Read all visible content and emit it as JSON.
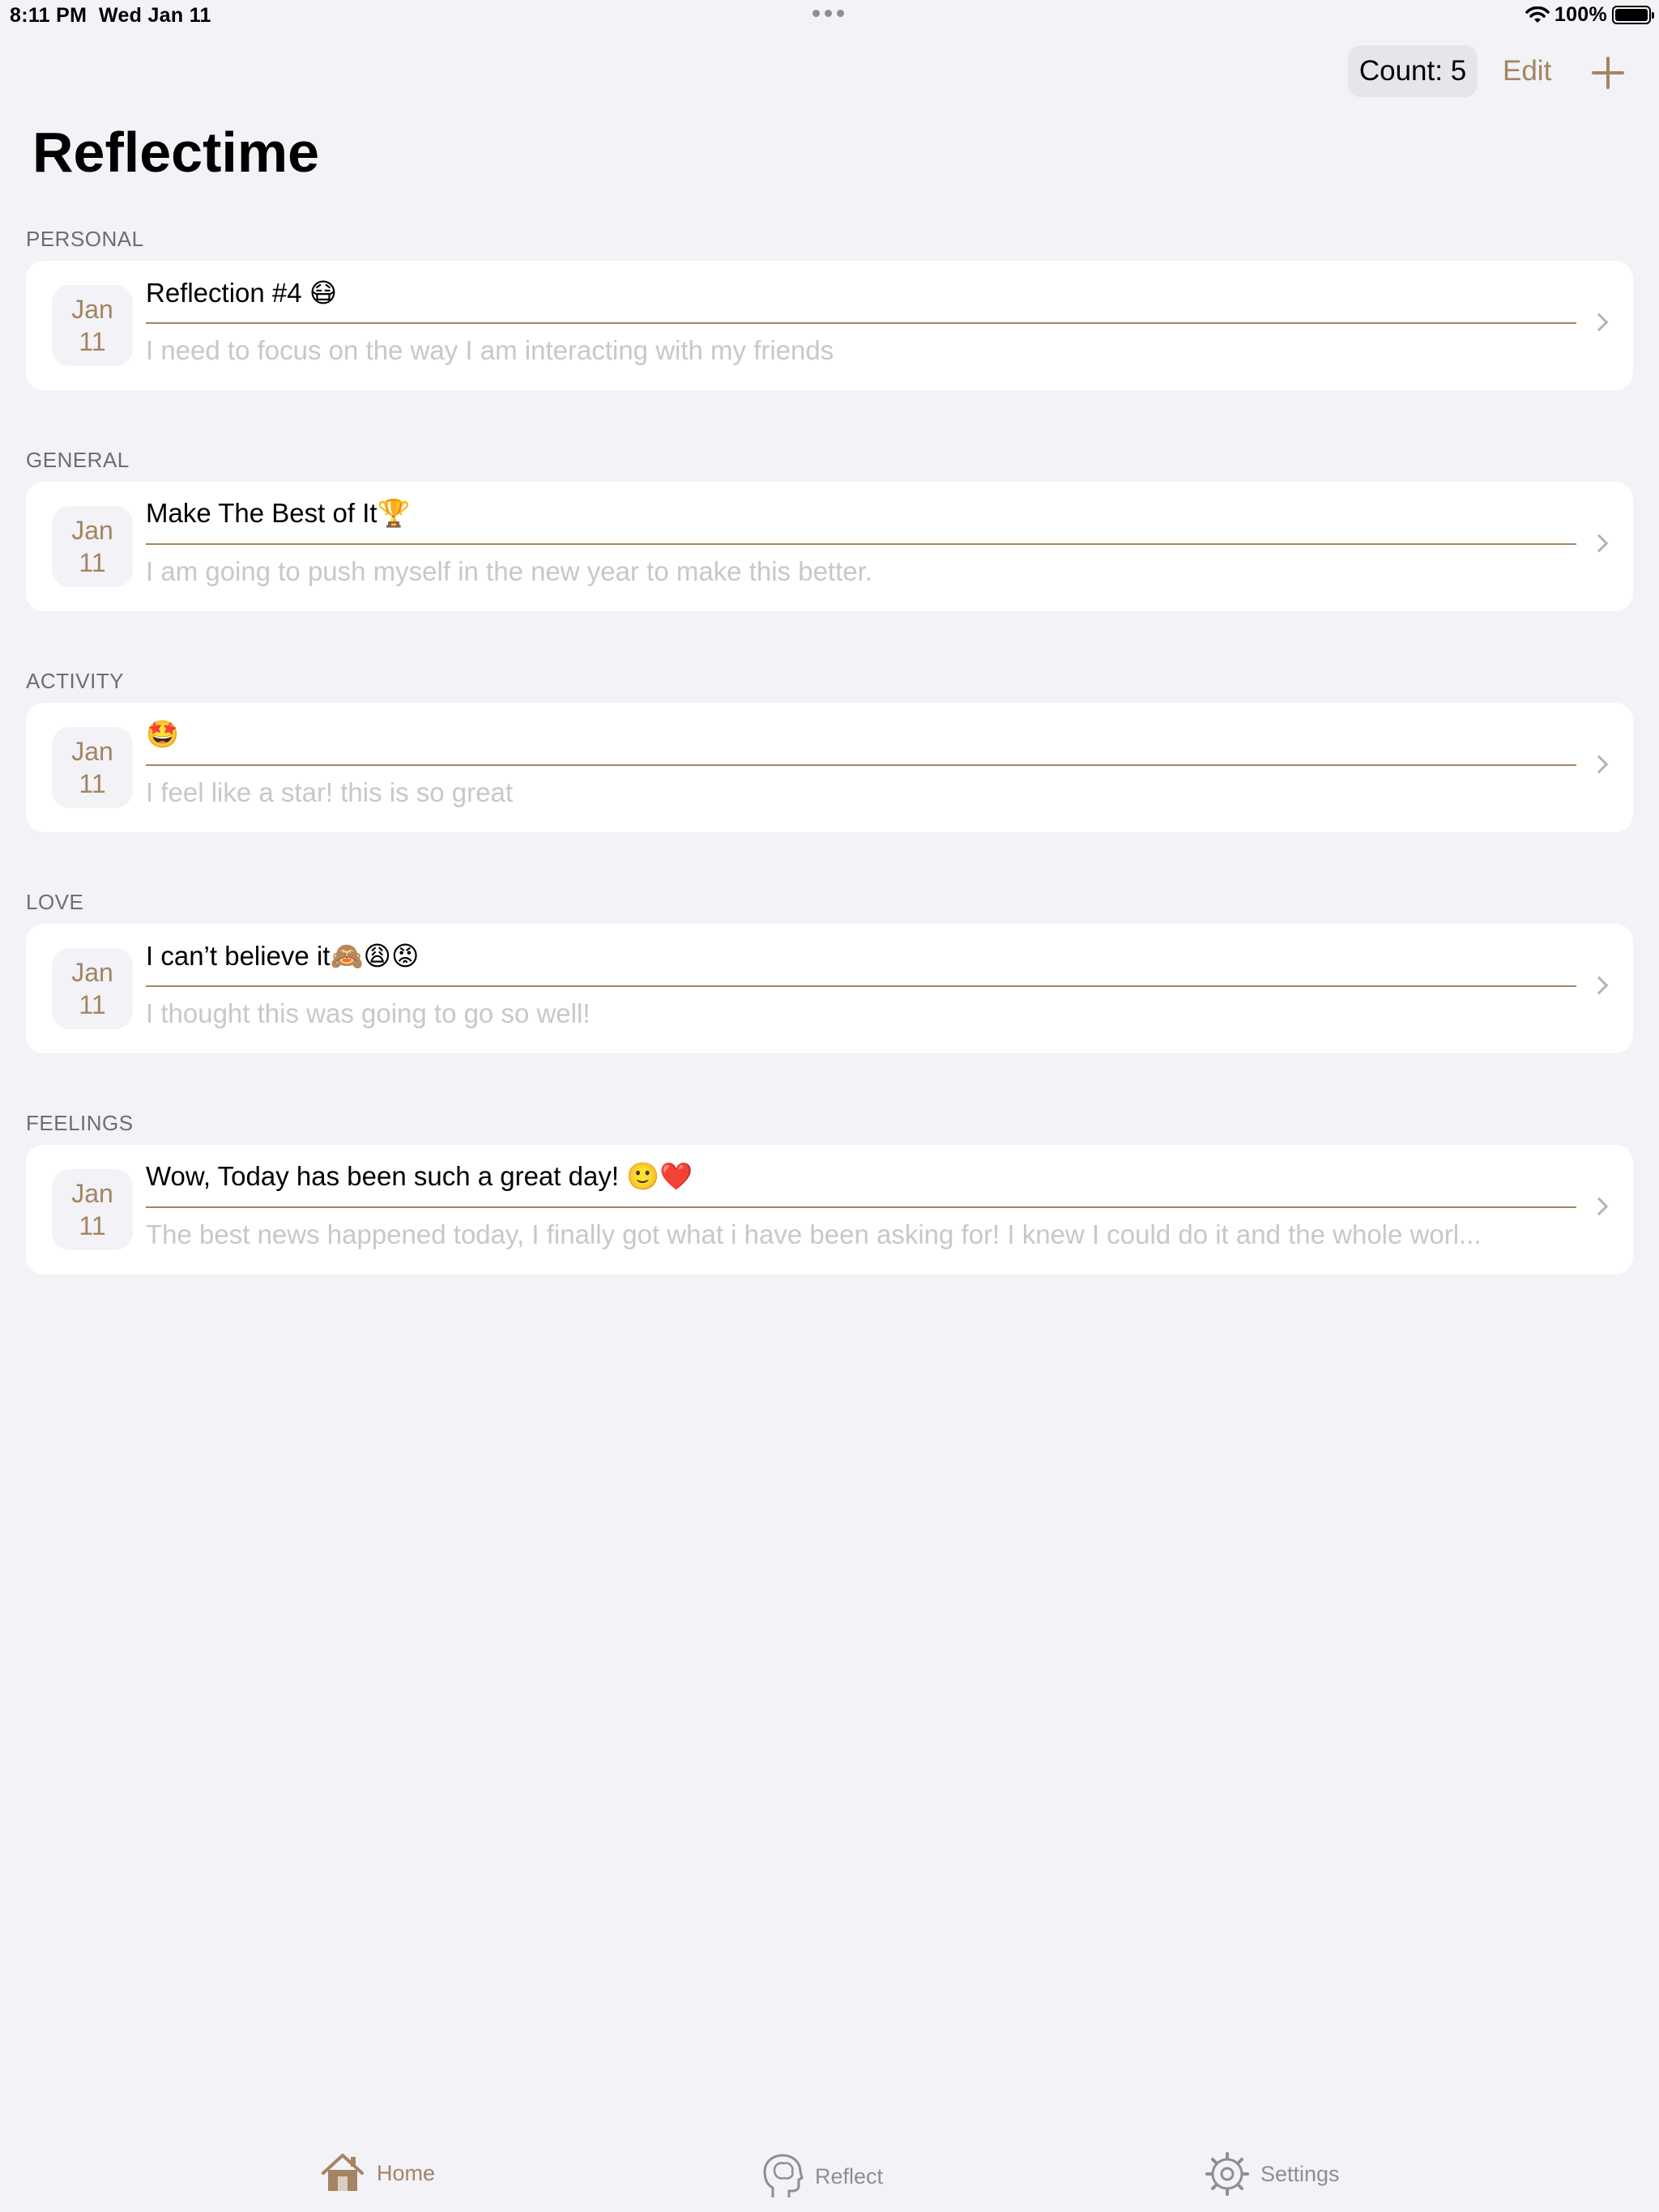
{
  "status_bar": {
    "time": "8:11 PM",
    "date": "Wed Jan 11",
    "battery": "100%"
  },
  "nav": {
    "count_label": "Count: 5",
    "edit_label": "Edit"
  },
  "title": "Reflectime",
  "sections": [
    {
      "header": "PERSONAL",
      "month": "Jan",
      "day": "11",
      "title": "Reflection #4 😷",
      "body": "I need to focus on the way I am interacting with my friends"
    },
    {
      "header": "GENERAL",
      "month": "Jan",
      "day": "11",
      "title": "Make The Best of It🏆",
      "body": "I am going to push myself in the new year to make this better."
    },
    {
      "header": "ACTIVITY",
      "month": "Jan",
      "day": "11",
      "title": "🤩",
      "body": "I feel like a star! this is so great"
    },
    {
      "header": "LOVE",
      "month": "Jan",
      "day": "11",
      "title": "I can’t believe it🙈😩😡",
      "body": "I thought this was going to go so well!"
    },
    {
      "header": "FEELINGS",
      "month": "Jan",
      "day": "11",
      "title": "Wow, Today has been such a great day! 🙂❤️",
      "body": "The best news happened today, I finally got what i have been asking for! I knew I could do it and the whole worl..."
    }
  ],
  "tabs": {
    "home": "Home",
    "reflect": "Reflect",
    "settings": "Settings"
  },
  "colors": {
    "accent": "#a48462",
    "background": "#f2f2f7",
    "card": "#ffffff",
    "muted": "#c7c7cc"
  }
}
